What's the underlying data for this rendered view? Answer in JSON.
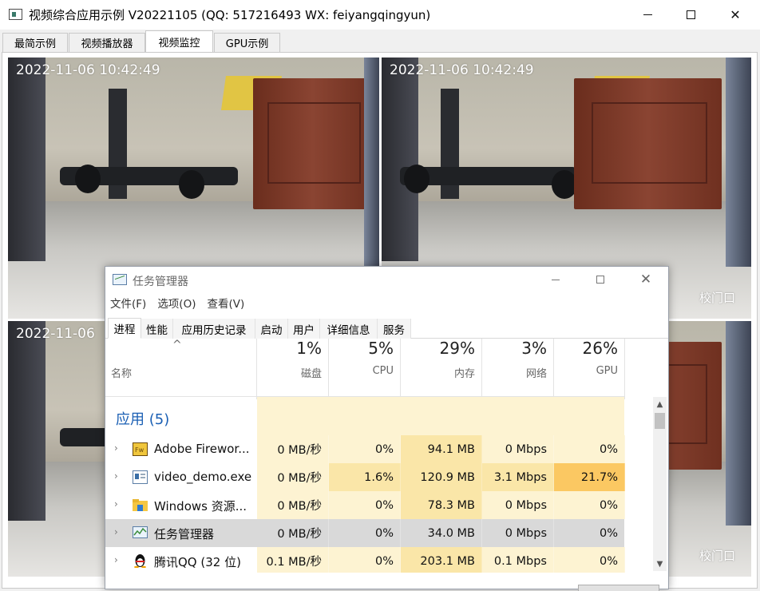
{
  "window": {
    "title": "视频综合应用示例 V20221105 (QQ: 517216493 WX: feiyangqingyun)",
    "minimize_icon": "minimize-icon",
    "maximize_icon": "maximize-icon",
    "close_glyph": "✕"
  },
  "tabs": [
    {
      "label": "最简示例",
      "active": false
    },
    {
      "label": "视频播放器",
      "active": false
    },
    {
      "label": "视频监控",
      "active": true
    },
    {
      "label": "GPU示例",
      "active": false
    }
  ],
  "videos": [
    {
      "timestamp": "2022-11-06 10:42:49",
      "label": ""
    },
    {
      "timestamp": "2022-11-06 10:42:49",
      "label": "校门口"
    },
    {
      "timestamp": "2022-11-06",
      "label": ""
    },
    {
      "timestamp": "",
      "label": "校门口"
    }
  ],
  "task_manager": {
    "title": "任务管理器",
    "close_glyph": "✕",
    "menu": [
      "文件(F)",
      "选项(O)",
      "查看(V)"
    ],
    "tabs": [
      {
        "label": "进程",
        "active": true
      },
      {
        "label": "性能",
        "active": false
      },
      {
        "label": "应用历史记录",
        "active": false
      },
      {
        "label": "启动",
        "active": false
      },
      {
        "label": "用户",
        "active": false
      },
      {
        "label": "详细信息",
        "active": false
      },
      {
        "label": "服务",
        "active": false
      }
    ],
    "sort_caret": "^",
    "name_header": "名称",
    "columns": [
      {
        "pct": "1%",
        "label": "磁盘"
      },
      {
        "pct": "5%",
        "label": "CPU"
      },
      {
        "pct": "29%",
        "label": "内存"
      },
      {
        "pct": "3%",
        "label": "网络"
      },
      {
        "pct": "26%",
        "label": "GPU"
      }
    ],
    "section_title": "应用 (5)",
    "expander_glyph": "›",
    "rows": [
      {
        "name": "Adobe Firewor...",
        "icon": "fireworks-icon",
        "disk": "0 MB/秒",
        "cpu": "0%",
        "mem": "94.1 MB",
        "net": "0 Mbps",
        "gpu": "0%"
      },
      {
        "name": "video_demo.exe",
        "icon": "app-window-icon",
        "disk": "0 MB/秒",
        "cpu": "1.6%",
        "mem": "120.9 MB",
        "net": "3.1 Mbps",
        "gpu": "21.7%"
      },
      {
        "name": "Windows 资源...",
        "icon": "folder-icon",
        "disk": "0 MB/秒",
        "cpu": "0%",
        "mem": "78.3 MB",
        "net": "0 Mbps",
        "gpu": "0%"
      },
      {
        "name": "任务管理器",
        "icon": "task-manager-icon",
        "disk": "0 MB/秒",
        "cpu": "0%",
        "mem": "34.0 MB",
        "net": "0 Mbps",
        "gpu": "0%",
        "selected": true
      },
      {
        "name": "腾讯QQ (32 位)",
        "icon": "qq-penguin-icon",
        "disk": "0.1 MB/秒",
        "cpu": "0%",
        "mem": "203.1 MB",
        "net": "0.1 Mbps",
        "gpu": "0%"
      }
    ],
    "scroll_up_glyph": "▲",
    "scroll_down_glyph": "▼",
    "colors": {
      "cell_light": "#fdf3d2",
      "cell_medium": "#fae6a8",
      "cell_hot": "#fbc862",
      "section_blue": "#1a5fb4",
      "selected_row": "#d9d9d9"
    }
  }
}
